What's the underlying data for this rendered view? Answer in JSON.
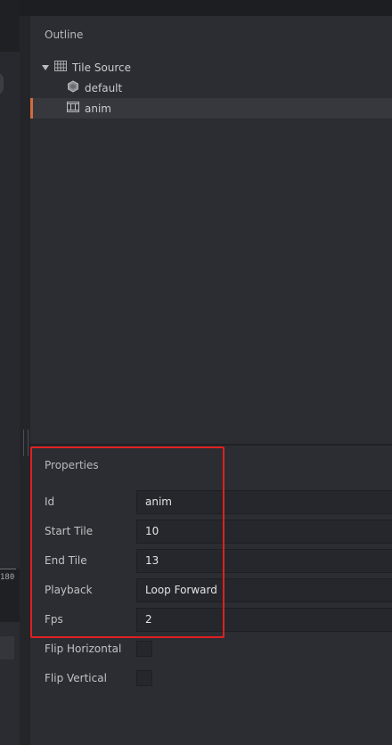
{
  "outline": {
    "title": "Outline",
    "tree": [
      {
        "label": "Tile Source",
        "icon": "grid-icon",
        "expanded": true
      },
      {
        "label": "default",
        "icon": "hexagon-icon"
      },
      {
        "label": "anim",
        "icon": "film-strip-icon",
        "selected": true
      }
    ]
  },
  "properties": {
    "title": "Properties",
    "id": {
      "label": "Id",
      "value": "anim"
    },
    "start_tile": {
      "label": "Start Tile",
      "value": "10"
    },
    "end_tile": {
      "label": "End Tile",
      "value": "13"
    },
    "playback": {
      "label": "Playback",
      "value": "Loop Forward"
    },
    "fps": {
      "label": "Fps",
      "value": "2"
    },
    "flip_horizontal": {
      "label": "Flip Horizontal",
      "checked": false
    },
    "flip_vertical": {
      "label": "Flip Vertical",
      "checked": false
    }
  },
  "viewport": {
    "ruler_label": "180"
  },
  "colors": {
    "selection_marker": "#d46a3f",
    "highlight": "#e02020"
  }
}
